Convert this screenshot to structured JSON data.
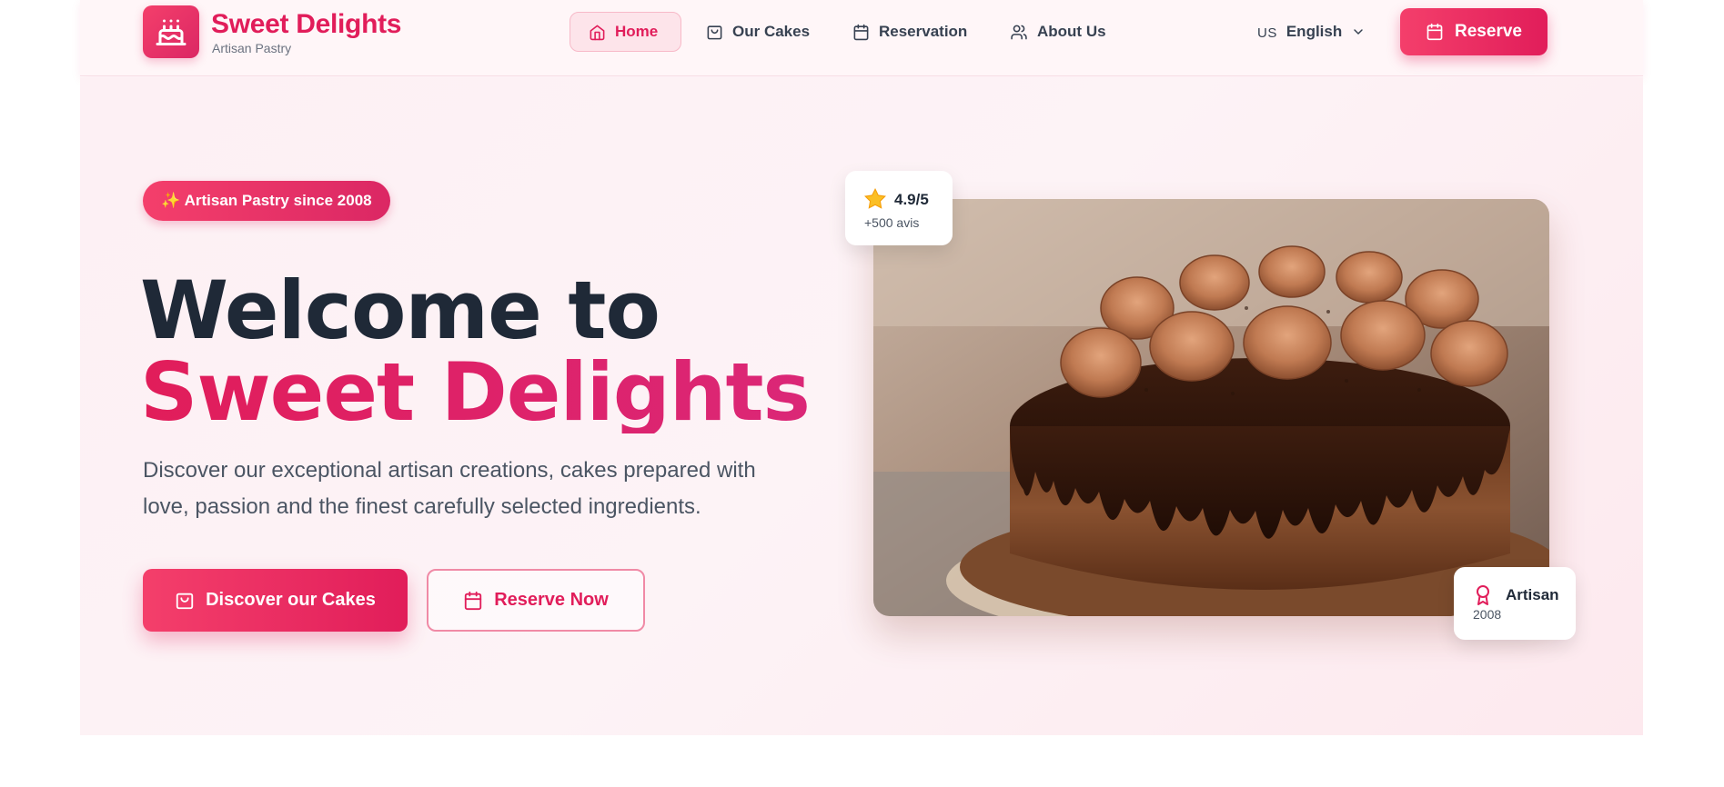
{
  "header": {
    "brand_name": "Sweet Delights",
    "brand_subtitle": "Artisan Pastry",
    "logo_icon": "cake-icon",
    "nav": [
      {
        "label": "Home",
        "icon": "home-icon",
        "active": true
      },
      {
        "label": "Our Cakes",
        "icon": "shopping-bag-icon",
        "active": false
      },
      {
        "label": "Reservation",
        "icon": "calendar-icon",
        "active": false
      },
      {
        "label": "About Us",
        "icon": "users-icon",
        "active": false
      }
    ],
    "language": {
      "code": "US",
      "label": "English"
    },
    "reserve_label": "Reserve"
  },
  "hero": {
    "badge": "✨ Artisan Pastry since 2008",
    "headline_line1": "Welcome to",
    "headline_line2": "Sweet Delights",
    "description": "Discover our exceptional artisan creations, cakes prepared with love, passion and the finest carefully selected ingredients.",
    "primary_cta": "Discover our Cakes",
    "secondary_cta": "Reserve Now",
    "rating": {
      "value": "4.9/5",
      "reviews": "+500 avis"
    },
    "artisan": {
      "title": "Artisan",
      "year": "2008"
    }
  },
  "colors": {
    "accent": "#e11d5a",
    "accent_light": "#f43f6b",
    "heading": "#1f2937",
    "text": "#4b5563",
    "hero_bg": "#fdf0f4"
  }
}
